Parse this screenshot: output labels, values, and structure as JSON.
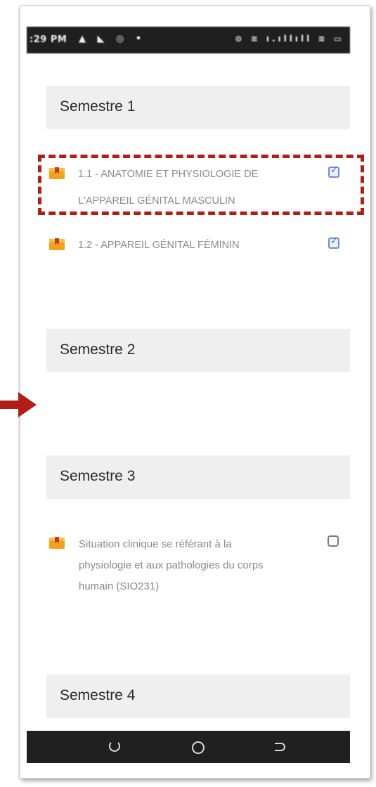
{
  "status_bar": {
    "time": ":29 PM",
    "left_icons": "▲ ◣ ◎ •",
    "right_icons": "⊙ ≋ ı.ıllıll ≋ ▭"
  },
  "sections": [
    {
      "title": "Semestre 1",
      "items": [
        {
          "label_line1": "1.1 - ANATOMIE ET PHYSIOLOGIE DE",
          "label_line2": "L'APPAREIL GÉNITAL MASCULIN",
          "checked": true,
          "icon": "lesson-bookmark-icon",
          "highlighted": true
        },
        {
          "label_line1": "1.2 - APPAREIL GÉNITAL FÉMININ",
          "checked": true,
          "icon": "lesson-bookmark-icon"
        }
      ]
    },
    {
      "title": "Semestre 2",
      "items": []
    },
    {
      "title": "Semestre 3",
      "items": [
        {
          "label_line1": "Situation clinique se référant à la",
          "label_line2": "physiologie et aux pathologies du corps",
          "label_line3": "humain (SIO231)",
          "checked": false,
          "icon": "lesson-bookmark-icon"
        }
      ]
    },
    {
      "title": "Semestre 4",
      "items": []
    }
  ],
  "nav_bar": {
    "recents_icon": "recents-icon",
    "home_icon": "home-icon",
    "back_icon": "back-icon"
  },
  "colors": {
    "highlight": "#b01e17",
    "arrow": "#b01e17",
    "icon_orange": "#f2a21a",
    "header_bg": "#efefef",
    "checkbox_blue": "#3d67b8"
  }
}
